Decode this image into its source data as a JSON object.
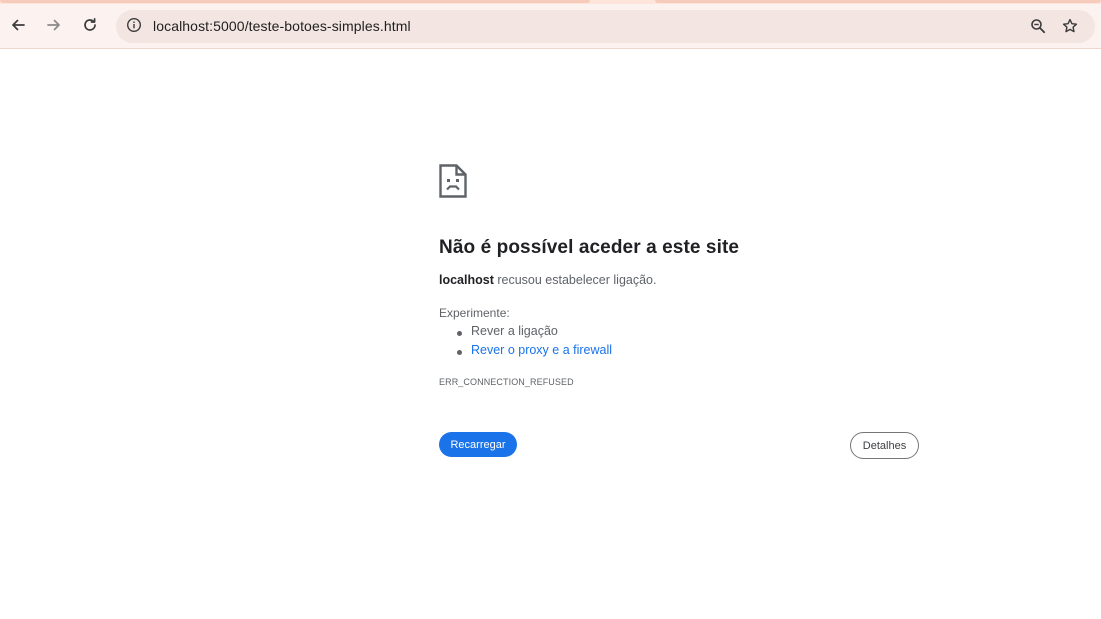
{
  "browser": {
    "url": "localhost:5000/teste-botoes-simples.html",
    "icons": {
      "back": "arrow-left-icon",
      "forward": "arrow-right-icon",
      "reload": "reload-icon",
      "site_info": "info-icon",
      "zoom": "zoom-icon",
      "bookmark": "star-icon"
    }
  },
  "error_page": {
    "title": "Não é possível aceder a este site",
    "host": "localhost",
    "summary_rest": " recusou estabelecer ligação.",
    "suggestions_heading": "Experimente:",
    "suggestions": [
      {
        "text": "Rever a ligação",
        "is_link": false
      },
      {
        "text": "Rever o proxy e a firewall",
        "is_link": true
      }
    ],
    "error_code": "ERR_CONNECTION_REFUSED",
    "reload_label": "Recarregar",
    "details_label": "Detalhes"
  },
  "colors": {
    "accent": "#1a73e8",
    "toolbar_bg": "#fcf2ef",
    "omnibox_bg": "#f2e5e2"
  }
}
